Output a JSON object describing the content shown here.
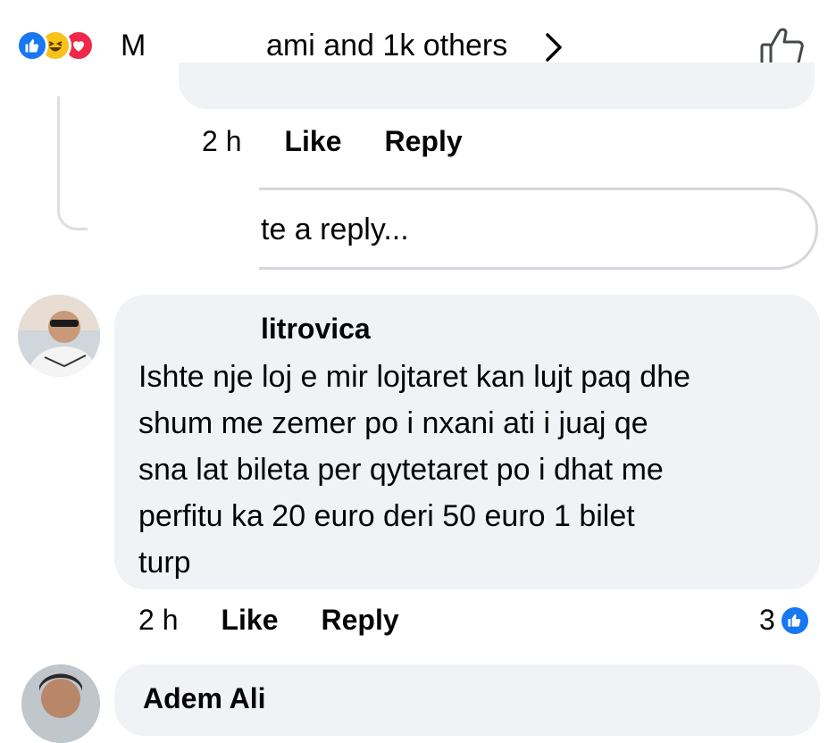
{
  "header": {
    "name_fragment": "M",
    "reaction_summary": "ami and 1k others",
    "reaction_types": [
      "like-icon",
      "haha-icon",
      "love-icon"
    ],
    "colors": {
      "like": "#1877f2",
      "haha": "#f7c21a",
      "love": "#f02849"
    }
  },
  "previous_reply": {
    "time": "2 h",
    "like_label": "Like",
    "reply_label": "Reply"
  },
  "reply_box": {
    "placeholder_fragment": "te a reply..."
  },
  "comment": {
    "author_fragment": "litrovica",
    "text_lines": [
      "Ishte nje loj e mir lojtaret kan lujt paq dhe",
      "shum me zemer po i nxani ati i juaj qe",
      "sna lat bileta per qytetaret po i dhat me",
      "perfitu ka 20 euro deri 50 euro 1 bilet",
      "turp"
    ],
    "time": "2 h",
    "like_label": "Like",
    "reply_label": "Reply",
    "reaction_count": "3"
  },
  "next_comment": {
    "author_fragment": "Adem Ali"
  }
}
